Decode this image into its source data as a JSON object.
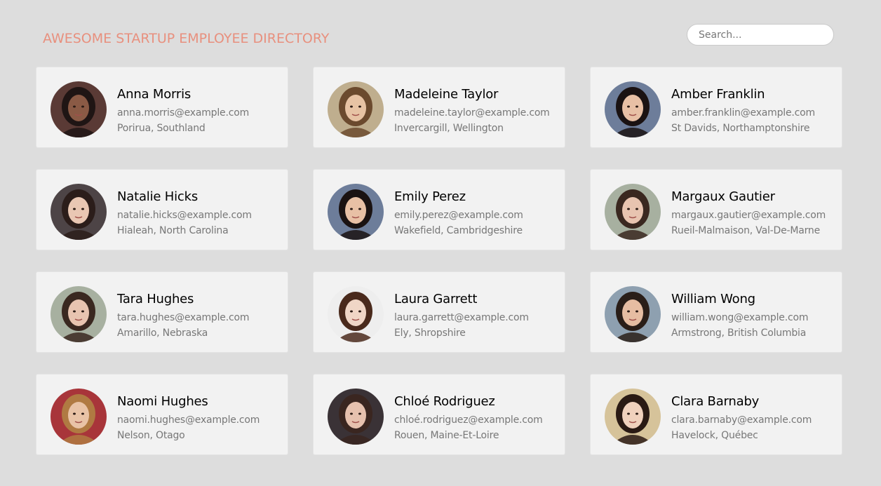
{
  "header": {
    "title": "AWESOME STARTUP EMPLOYEE DIRECTORY",
    "title_color": "#e8907e",
    "search_placeholder": "Search..."
  },
  "employees": [
    {
      "name": "Anna Morris",
      "email": "anna.morris@example.com",
      "location": "Porirua, Southland",
      "bg": "#5a3a35",
      "skin": "#8a5a45",
      "hair": "#1f1514"
    },
    {
      "name": "Madeleine Taylor",
      "email": "madeleine.taylor@example.com",
      "location": "Invercargill, Wellington",
      "bg": "#bfae8e",
      "skin": "#e7c3a4",
      "hair": "#6b4a2e"
    },
    {
      "name": "Amber Franklin",
      "email": "amber.franklin@example.com",
      "location": "St Davids, Northamptonshire",
      "bg": "#6d7d9a",
      "skin": "#e8c0a5",
      "hair": "#1a1212"
    },
    {
      "name": "Natalie Hicks",
      "email": "natalie.hicks@example.com",
      "location": "Hialeah, North Carolina",
      "bg": "#4d4446",
      "skin": "#e9c7b3",
      "hair": "#2b1d1a"
    },
    {
      "name": "Emily Perez",
      "email": "emily.perez@example.com",
      "location": "Wakefield, Cambridgeshire",
      "bg": "#6d7d9a",
      "skin": "#e8c0a5",
      "hair": "#1a1212"
    },
    {
      "name": "Margaux Gautier",
      "email": "margaux.gautier@example.com",
      "location": "Rueil-Malmaison, Val-De-Marne",
      "bg": "#a7b0a0",
      "skin": "#e8c4b0",
      "hair": "#3a2820"
    },
    {
      "name": "Tara Hughes",
      "email": "tara.hughes@example.com",
      "location": "Amarillo, Nebraska",
      "bg": "#a7b0a0",
      "skin": "#e8c4b0",
      "hair": "#3a2820"
    },
    {
      "name": "Laura Garrett",
      "email": "laura.garrett@example.com",
      "location": "Ely, Shropshire",
      "bg": "#eeeeee",
      "skin": "#f0d6c6",
      "hair": "#4a2a1c"
    },
    {
      "name": "William Wong",
      "email": "william.wong@example.com",
      "location": "Armstrong, British Columbia",
      "bg": "#8ea0b0",
      "skin": "#e6bda2",
      "hair": "#2a1e18"
    },
    {
      "name": "Naomi Hughes",
      "email": "naomi.hughes@example.com",
      "location": "Nelson, Otago",
      "bg": "#a8353a",
      "skin": "#e9c3a6",
      "hair": "#b07a42"
    },
    {
      "name": "Chloé Rodriguez",
      "email": "chloé.rodriguez@example.com",
      "location": "Rouen, Maine-Et-Loire",
      "bg": "#3a3236",
      "skin": "#e6c1ae",
      "hair": "#3a2620"
    },
    {
      "name": "Clara Barnaby",
      "email": "clara.barnaby@example.com",
      "location": "Havelock, Québec",
      "bg": "#d6c39a",
      "skin": "#f0d1bd",
      "hair": "#2a1a14"
    }
  ]
}
